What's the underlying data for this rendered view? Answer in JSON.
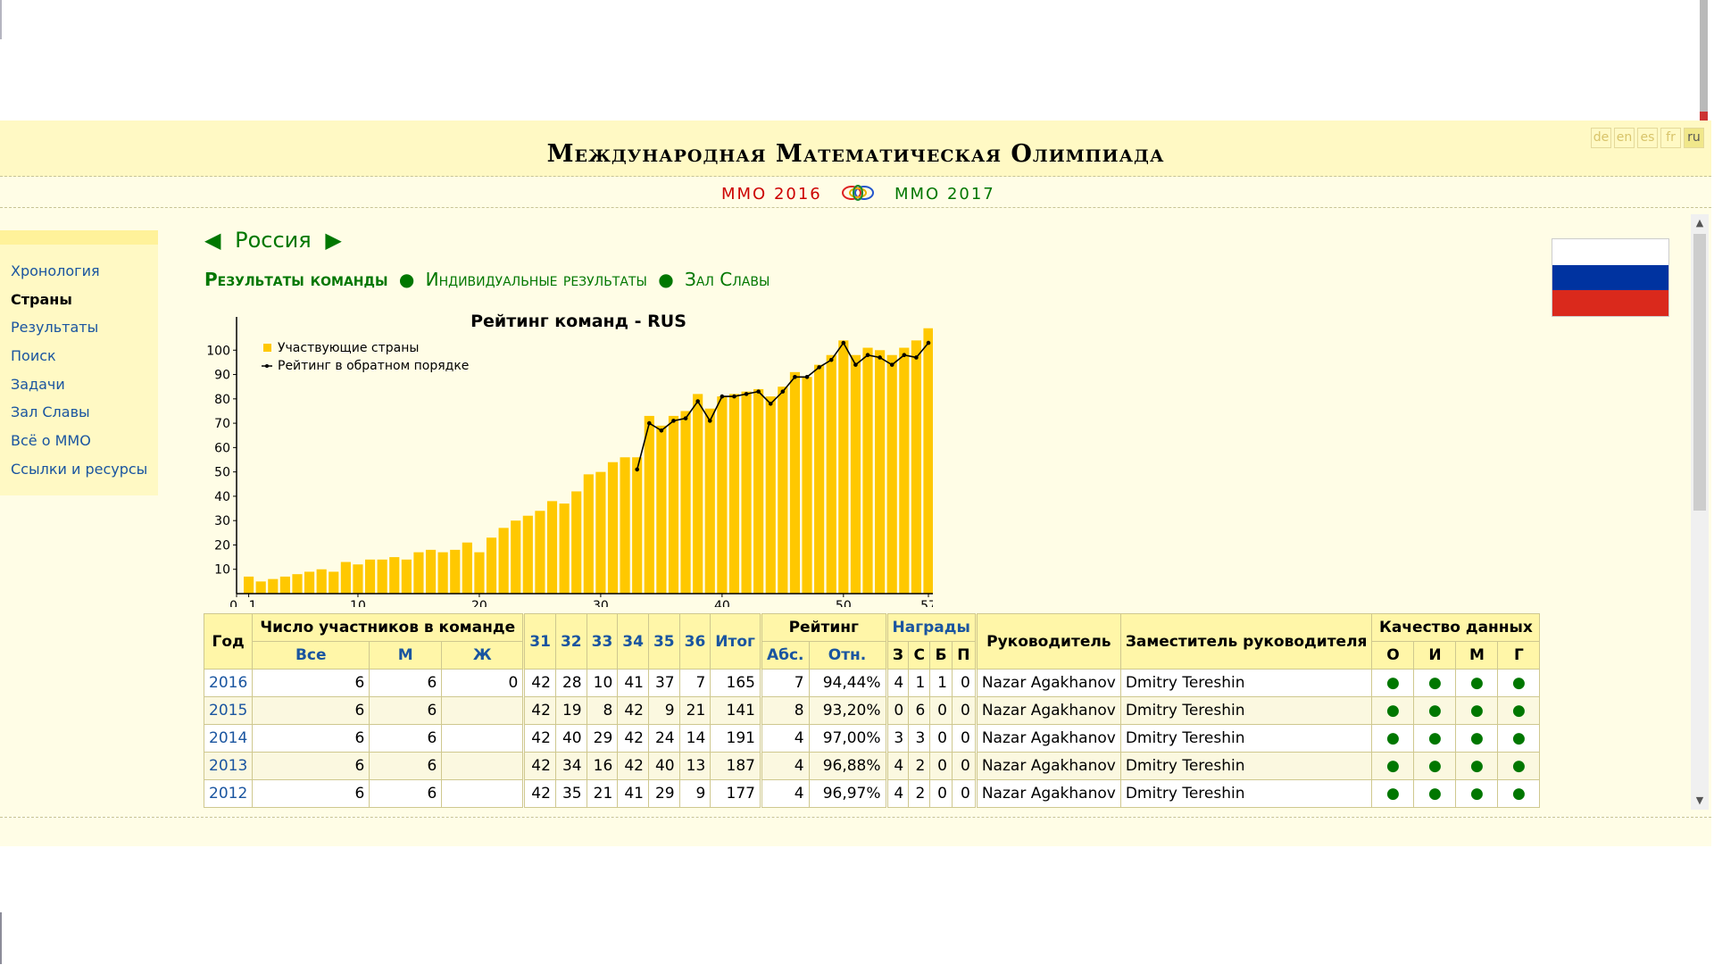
{
  "site_title": "Международная Математическая Олимпиада",
  "languages": [
    {
      "code": "de",
      "current": false
    },
    {
      "code": "en",
      "current": false
    },
    {
      "code": "es",
      "current": false
    },
    {
      "code": "fr",
      "current": false
    },
    {
      "code": "ru",
      "current": true
    }
  ],
  "subnav": {
    "prev": "ММО 2016",
    "next": "ММО 2017",
    "logo_icon": "imo-rings-logo"
  },
  "sidebar": {
    "items": [
      {
        "label": "Хронология",
        "active": false
      },
      {
        "label": "Страны",
        "active": true
      },
      {
        "label": "Результаты",
        "active": false
      },
      {
        "label": "Поиск",
        "active": false
      },
      {
        "label": "Задачи",
        "active": false
      },
      {
        "label": "Зал Славы",
        "active": false
      },
      {
        "label": "Всё о ММО",
        "active": false
      },
      {
        "label": "Ссылки и ресурсы",
        "active": false
      }
    ]
  },
  "country": {
    "name": "Россия",
    "prev_arrow": "◀",
    "next_arrow": "▶"
  },
  "tabs": {
    "team": "Результаты команды",
    "individual": "Индивидуальные результаты",
    "hall": "Зал Славы",
    "dot": "●"
  },
  "flag": {
    "colors": [
      "#ffffff",
      "#0033a0",
      "#da291c"
    ]
  },
  "chart_data": {
    "type": "bar",
    "title": "Рейтинг команд - RUS",
    "legend": [
      "Участвующие страны",
      "Рейтинг в обратном порядке"
    ],
    "legend_placement": "top-left",
    "colors": {
      "bars": "#ffc800",
      "line": "#000000"
    },
    "xlim": [
      0,
      57
    ],
    "ylim": [
      0,
      110
    ],
    "x_ticks": [
      0,
      1,
      10,
      20,
      30,
      40,
      50,
      57
    ],
    "y_ticks": [
      10,
      20,
      30,
      40,
      50,
      60,
      70,
      80,
      90,
      100
    ],
    "series": [
      {
        "name": "Участвующие страны",
        "x": [
          1,
          2,
          3,
          4,
          5,
          6,
          7,
          8,
          9,
          10,
          11,
          12,
          13,
          14,
          15,
          16,
          17,
          18,
          19,
          20,
          21,
          22,
          23,
          24,
          25,
          26,
          27,
          28,
          29,
          30,
          31,
          32,
          33,
          34,
          35,
          36,
          37,
          38,
          39,
          40,
          41,
          42,
          43,
          44,
          45,
          46,
          47,
          48,
          49,
          50,
          51,
          52,
          53,
          54,
          55,
          56,
          57
        ],
        "values": [
          7,
          5,
          6,
          7,
          8,
          9,
          10,
          9,
          13,
          12,
          14,
          14,
          15,
          14,
          17,
          18,
          17,
          18,
          21,
          17,
          23,
          27,
          30,
          32,
          34,
          38,
          37,
          42,
          49,
          50,
          54,
          56,
          56,
          73,
          69,
          73,
          75,
          82,
          76,
          81,
          82,
          83,
          84,
          81,
          85,
          91,
          89,
          94,
          98,
          104,
          98,
          101,
          100,
          98,
          101,
          104,
          109
        ]
      },
      {
        "name": "Рейтинг в обратном порядке",
        "x": [
          33,
          34,
          35,
          36,
          37,
          38,
          39,
          40,
          41,
          42,
          43,
          44,
          45,
          46,
          47,
          48,
          49,
          50,
          51,
          52,
          53,
          54,
          55,
          56,
          57
        ],
        "values": [
          51,
          70,
          67,
          71,
          72,
          79,
          71,
          81,
          81,
          82,
          83,
          78,
          83,
          89,
          89,
          93,
          96,
          103,
          94,
          98,
          97,
          94,
          98,
          97,
          103
        ]
      }
    ]
  },
  "table": {
    "headers": {
      "year": "Год",
      "participants": "Число участников в команде",
      "all": "Все",
      "m": "М",
      "f": "Ж",
      "problems": [
        "31",
        "32",
        "33",
        "34",
        "35",
        "36"
      ],
      "total": "Итог",
      "rank": "Рейтинг",
      "abs": "Абс.",
      "rel": "Отн.",
      "awards": "Награды",
      "g": "З",
      "s": "С",
      "b": "Б",
      "hm": "П",
      "leader": "Руководитель",
      "deputy": "Заместитель руководителя",
      "quality": "Качество данных",
      "q1": "О",
      "q2": "И",
      "q3": "М",
      "q4": "Г"
    },
    "rows": [
      {
        "year": "2016",
        "all": "6",
        "m": "6",
        "f": "0",
        "p": [
          "42",
          "28",
          "10",
          "41",
          "37",
          "7"
        ],
        "total": "165",
        "abs": "7",
        "rel": "94,44%",
        "g": "4",
        "s": "1",
        "b": "1",
        "hm": "0",
        "leader": "Nazar Agakhanov",
        "deputy": "Dmitry Tereshin",
        "q": [
          "●",
          "●",
          "●",
          "●"
        ]
      },
      {
        "year": "2015",
        "all": "6",
        "m": "6",
        "f": "",
        "p": [
          "42",
          "19",
          "8",
          "42",
          "9",
          "21"
        ],
        "total": "141",
        "abs": "8",
        "rel": "93,20%",
        "g": "0",
        "s": "6",
        "b": "0",
        "hm": "0",
        "leader": "Nazar Agakhanov",
        "deputy": "Dmitry Tereshin",
        "q": [
          "●",
          "●",
          "●",
          "●"
        ]
      },
      {
        "year": "2014",
        "all": "6",
        "m": "6",
        "f": "",
        "p": [
          "42",
          "40",
          "29",
          "42",
          "24",
          "14"
        ],
        "total": "191",
        "abs": "4",
        "rel": "97,00%",
        "g": "3",
        "s": "3",
        "b": "0",
        "hm": "0",
        "leader": "Nazar Agakhanov",
        "deputy": "Dmitry Tereshin",
        "q": [
          "●",
          "●",
          "●",
          "●"
        ]
      },
      {
        "year": "2013",
        "all": "6",
        "m": "6",
        "f": "",
        "p": [
          "42",
          "34",
          "16",
          "42",
          "40",
          "13"
        ],
        "total": "187",
        "abs": "4",
        "rel": "96,88%",
        "g": "4",
        "s": "2",
        "b": "0",
        "hm": "0",
        "leader": "Nazar Agakhanov",
        "deputy": "Dmitry Tereshin",
        "q": [
          "●",
          "●",
          "●",
          "●"
        ]
      },
      {
        "year": "2012",
        "all": "6",
        "m": "6",
        "f": "",
        "p": [
          "42",
          "35",
          "21",
          "41",
          "29",
          "9"
        ],
        "total": "177",
        "abs": "4",
        "rel": "96,97%",
        "g": "4",
        "s": "2",
        "b": "0",
        "hm": "0",
        "leader": "Nazar Agakhanov",
        "deputy": "Dmitry Tereshin",
        "q": [
          "●",
          "●",
          "●",
          "●"
        ]
      }
    ]
  }
}
